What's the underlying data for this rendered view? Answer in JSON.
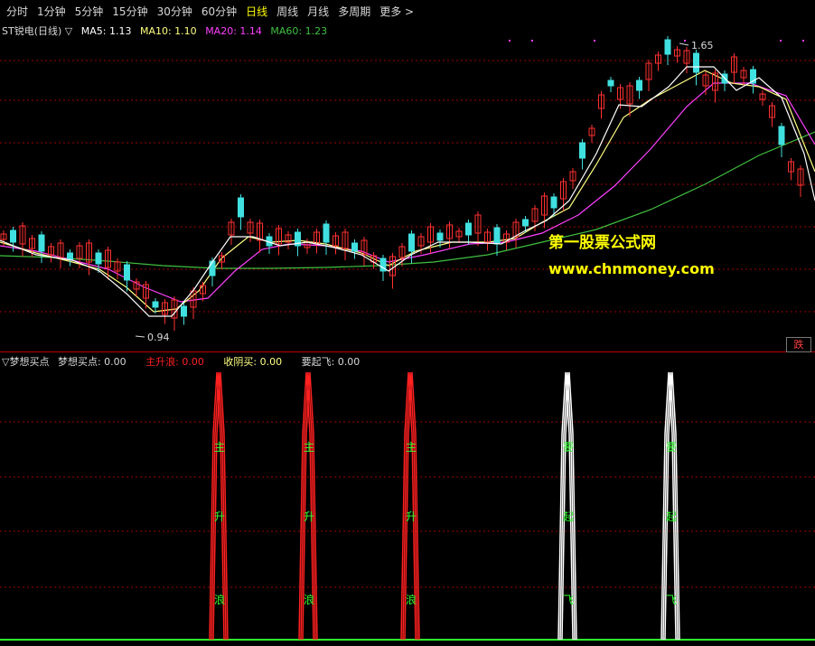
{
  "tabs": [
    {
      "label": "分时",
      "active": false
    },
    {
      "label": "1分钟",
      "active": false
    },
    {
      "label": "5分钟",
      "active": false
    },
    {
      "label": "15分钟",
      "active": false
    },
    {
      "label": "30分钟",
      "active": false
    },
    {
      "label": "60分钟",
      "active": false
    },
    {
      "label": "日线",
      "active": true
    },
    {
      "label": "周线",
      "active": false
    },
    {
      "label": "月线",
      "active": false
    },
    {
      "label": "多周期",
      "active": false
    },
    {
      "label": "更多 >",
      "active": false
    }
  ],
  "main_legend": {
    "stock": "ST锐电(日线) ▽",
    "ma5": "MA5: 1.13",
    "ma10": "MA10: 1.10",
    "ma20": "MA20: 1.14",
    "ma60": "MA60: 1.23"
  },
  "price_marks": {
    "high": "1.65",
    "low": "0.94"
  },
  "watermark": {
    "line1": "第一股票公式网",
    "line2": "www.chnmoney.com"
  },
  "fall_button": "跌",
  "indicator_legend": {
    "name": "▽梦想买点",
    "v0": "梦想买点: 0.00",
    "v1": "主升浪: 0.00",
    "v2": "收阴买: 0.00",
    "v3": "要起飞: 0.00"
  },
  "signals": [
    {
      "chars": [
        "主",
        "升",
        "浪"
      ],
      "color": "#ff2020"
    },
    {
      "chars": [
        "主",
        "升",
        "浪"
      ],
      "color": "#ff2020"
    },
    {
      "chars": [
        "主",
        "升",
        "浪"
      ],
      "color": "#ff2020"
    },
    {
      "chars": [
        "要",
        "起",
        "飞"
      ],
      "color": "#ffffff"
    },
    {
      "chars": [
        "要",
        "起",
        "飞"
      ],
      "color": "#ffffff"
    }
  ],
  "colors": {
    "ma5": "#ffffff",
    "ma10": "#ffff80",
    "ma20": "#ff40ff",
    "ma60": "#40c040",
    "up": "#ff3030",
    "down": "#40e0e0",
    "grid": "#9b0000",
    "signal_text": "#30ff30"
  }
}
